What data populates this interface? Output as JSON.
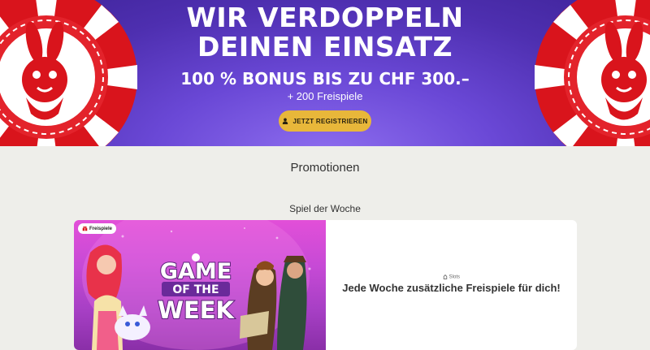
{
  "hero": {
    "title_line1": "WIR VERDOPPELN",
    "title_line2": "DEINEN EINSATZ",
    "bonus": "100 % BONUS BIS ZU CHF 300.–",
    "freispiele": "+ 200 Freispiele",
    "register_button": "JETZT REGISTRIEREN",
    "user_icon": "user-icon",
    "chip_color": "#d9141c"
  },
  "promotions": {
    "title": "Promotionen"
  },
  "spiel_der_woche": {
    "title": "Spiel der Woche",
    "card": {
      "badge": "Freispiele",
      "badge_icon": "gift-icon",
      "logo_line1": "GAME",
      "logo_line2": "OF THE",
      "logo_line3": "WEEK",
      "category": "Slots",
      "category_icon": "slots-icon",
      "heading": "Jede Woche zusätzliche Freispiele für dich!"
    }
  }
}
